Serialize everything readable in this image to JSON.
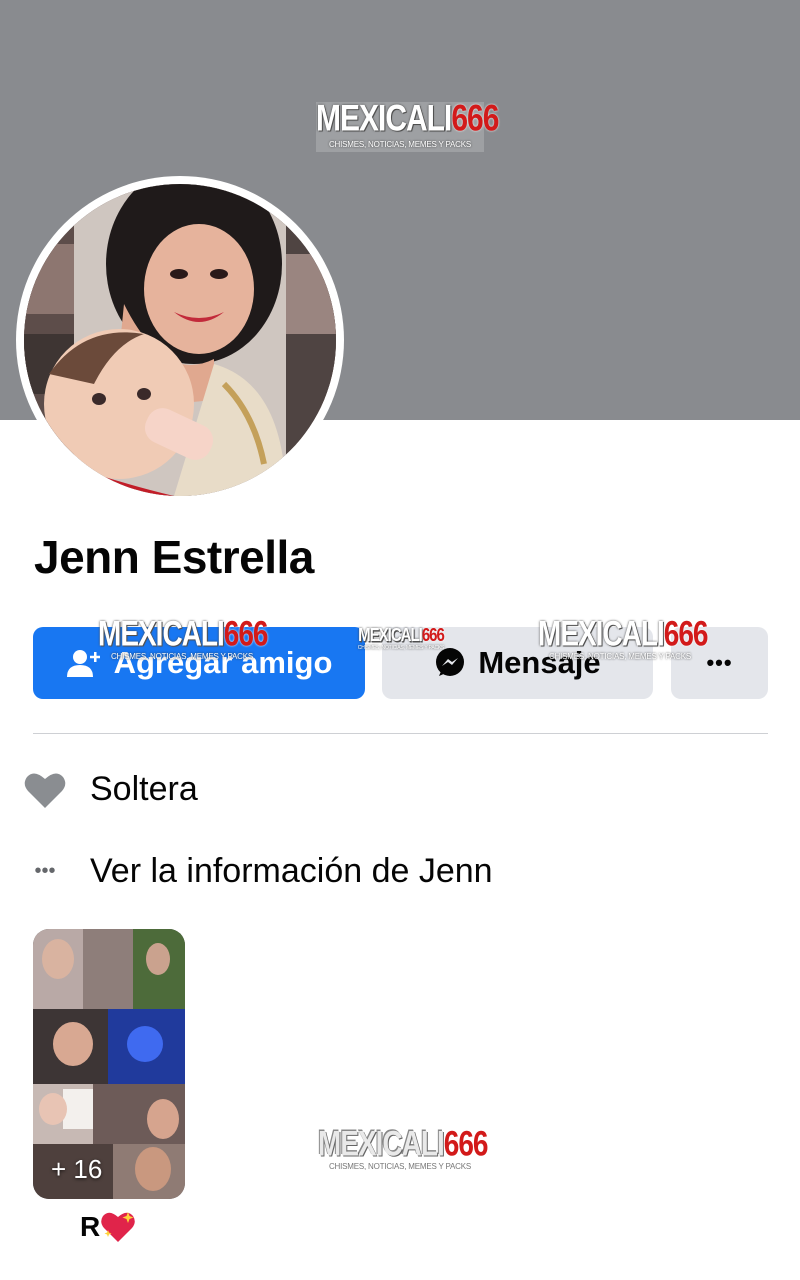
{
  "watermark": {
    "brand_white": "MEXICALI",
    "brand_red": "666",
    "tagline": "CHISMES, NOTICIAS, MEMES Y PACKS"
  },
  "profile": {
    "name": "Jenn Estrella"
  },
  "actions": {
    "add_friend_label": "Agregar amigo",
    "message_label": "Mensaje",
    "more_label": "•••"
  },
  "about": {
    "relationship": "Soltera",
    "see_info": "Ver la información de Jenn",
    "see_info_icon_text": "•••"
  },
  "story": {
    "count_label": "+ 16",
    "label": "R"
  },
  "colors": {
    "primary": "#1877f2",
    "secondary_button": "#e4e6eb",
    "cover": "#898b8f"
  }
}
